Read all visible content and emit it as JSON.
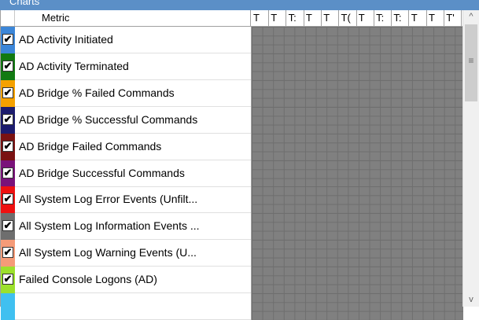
{
  "panel": {
    "title_fragment": "Charts"
  },
  "header": {
    "metric_label": "Metric",
    "columns": [
      "T",
      "T",
      "T:",
      "T",
      "T",
      "T(",
      "T",
      "T:",
      "T:",
      "T",
      "T",
      "T'"
    ]
  },
  "rows": [
    {
      "label": "AD Activity Initiated",
      "color": "#3c86d8",
      "checked": true
    },
    {
      "label": "AD Activity Terminated",
      "color": "#127a12",
      "checked": true
    },
    {
      "label": "AD Bridge % Failed Commands",
      "color": "#f5a100",
      "checked": true
    },
    {
      "label": "AD Bridge % Successful Commands",
      "color": "#1c1c6e",
      "checked": true
    },
    {
      "label": "AD Bridge Failed Commands",
      "color": "#7a1212",
      "checked": true
    },
    {
      "label": "AD Bridge Successful Commands",
      "color": "#7a127a",
      "checked": true
    },
    {
      "label": "All System Log Error Events (Unfilt...",
      "color": "#ee1111",
      "checked": true
    },
    {
      "label": "All System Log Information Events ...",
      "color": "#6e6e6e",
      "checked": true
    },
    {
      "label": "All System Log Warning Events (U...",
      "color": "#f59b78",
      "checked": true
    },
    {
      "label": "Failed Console Logons (AD)",
      "color": "#9ce02c",
      "checked": true
    },
    {
      "label": "",
      "color": "#40c0f0",
      "checked": false
    }
  ],
  "scrollbar": {
    "up": "^",
    "down": "v",
    "grip": "≡"
  }
}
